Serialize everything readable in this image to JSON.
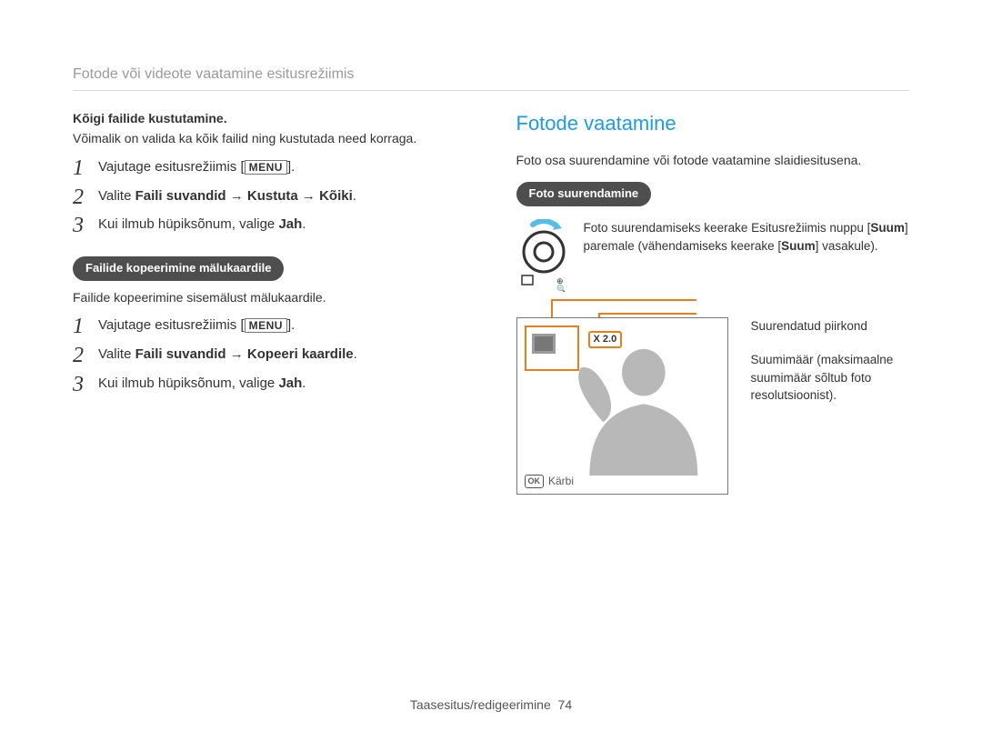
{
  "header": "Fotode või videote vaatamine esitusrežiimis",
  "left": {
    "s1_title": "Kõigi failide kustutamine.",
    "s1_text": "Võimalik on valida ka kõik failid ning kustutada need korraga.",
    "steps1": {
      "a": "Vajutage esitusrežiimis [",
      "menu": "MENU",
      "a2": "].",
      "b1": "Valite  ",
      "b2": "Faili suvandid → Kustuta → Kõiki",
      "b3": ".",
      "c1": "Kui ilmub hüpiksõnum, valige ",
      "c2": "Jah",
      "c3": "."
    },
    "pill2": "Failide kopeerimine mälukaardile",
    "s2_text": "Failide kopeerimine sisemälust mälukaardile.",
    "steps2": {
      "a": "Vajutage esitusrežiimis [",
      "menu": "MENU",
      "a2": "].",
      "b1": "Valite ",
      "b2": "Faili suvandid → Kopeeri kaardile",
      "b3": ".",
      "c1": "Kui ilmub hüpiksõnum, valige ",
      "c2": "Jah",
      "c3": "."
    }
  },
  "right": {
    "title": "Fotode vaatamine",
    "intro": "Foto osa suurendamine või fotode vaatamine slaidiesitusena.",
    "pill": "Foto suurendamine",
    "knob_text_1": "Foto suurendamiseks keerake Esitusrežiimis nuppu [",
    "knob_b1": "Suum",
    "knob_text_2": "] paremale (vähendamiseks keerake [",
    "knob_b2": "Suum",
    "knob_text_3": "] vasakule).",
    "badge": "X 2.0",
    "crop": "Kärbi",
    "label1": "Suurendatud piirkond",
    "label2": "Suumimäär (maksimaalne suumimäär sõltub foto resolutsioonist)."
  },
  "footer": {
    "text": "Taasesitus/redigeerimine",
    "page": "74"
  }
}
